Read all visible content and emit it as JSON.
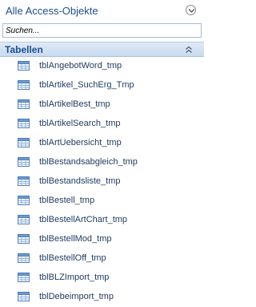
{
  "pane": {
    "title": "Alle Access-Objekte",
    "dropdown_icon": "chevron-down-circle-icon"
  },
  "search": {
    "placeholder": "Suchen...",
    "value": ""
  },
  "group": {
    "label": "Tabellen",
    "collapse_icon": "double-chevron-up-icon"
  },
  "items": [
    {
      "label": "tblAngebotWord_tmp",
      "icon": "table-icon"
    },
    {
      "label": "tblArtikel_SuchErg_Tmp",
      "icon": "table-icon"
    },
    {
      "label": "tblArtikelBest_tmp",
      "icon": "table-icon"
    },
    {
      "label": "tblArtikelSearch_tmp",
      "icon": "table-icon"
    },
    {
      "label": "tblArtUebersicht_tmp",
      "icon": "table-icon"
    },
    {
      "label": "tblBestandsabgleich_tmp",
      "icon": "table-icon"
    },
    {
      "label": "tblBestandsliste_tmp",
      "icon": "table-icon"
    },
    {
      "label": "tblBestell_tmp",
      "icon": "table-icon"
    },
    {
      "label": "tblBestellArtChart_tmp",
      "icon": "table-icon"
    },
    {
      "label": "tblBestellMod_tmp",
      "icon": "table-icon"
    },
    {
      "label": "tblBestellOff_tmp",
      "icon": "table-icon"
    },
    {
      "label": "tblBLZImport_tmp",
      "icon": "table-icon"
    },
    {
      "label": "tblDebeimport_tmp",
      "icon": "table-icon"
    }
  ],
  "colors": {
    "title": "#1f4e8c",
    "item_text": "#1e3a5f",
    "group_bg": "#c9dbf0"
  }
}
